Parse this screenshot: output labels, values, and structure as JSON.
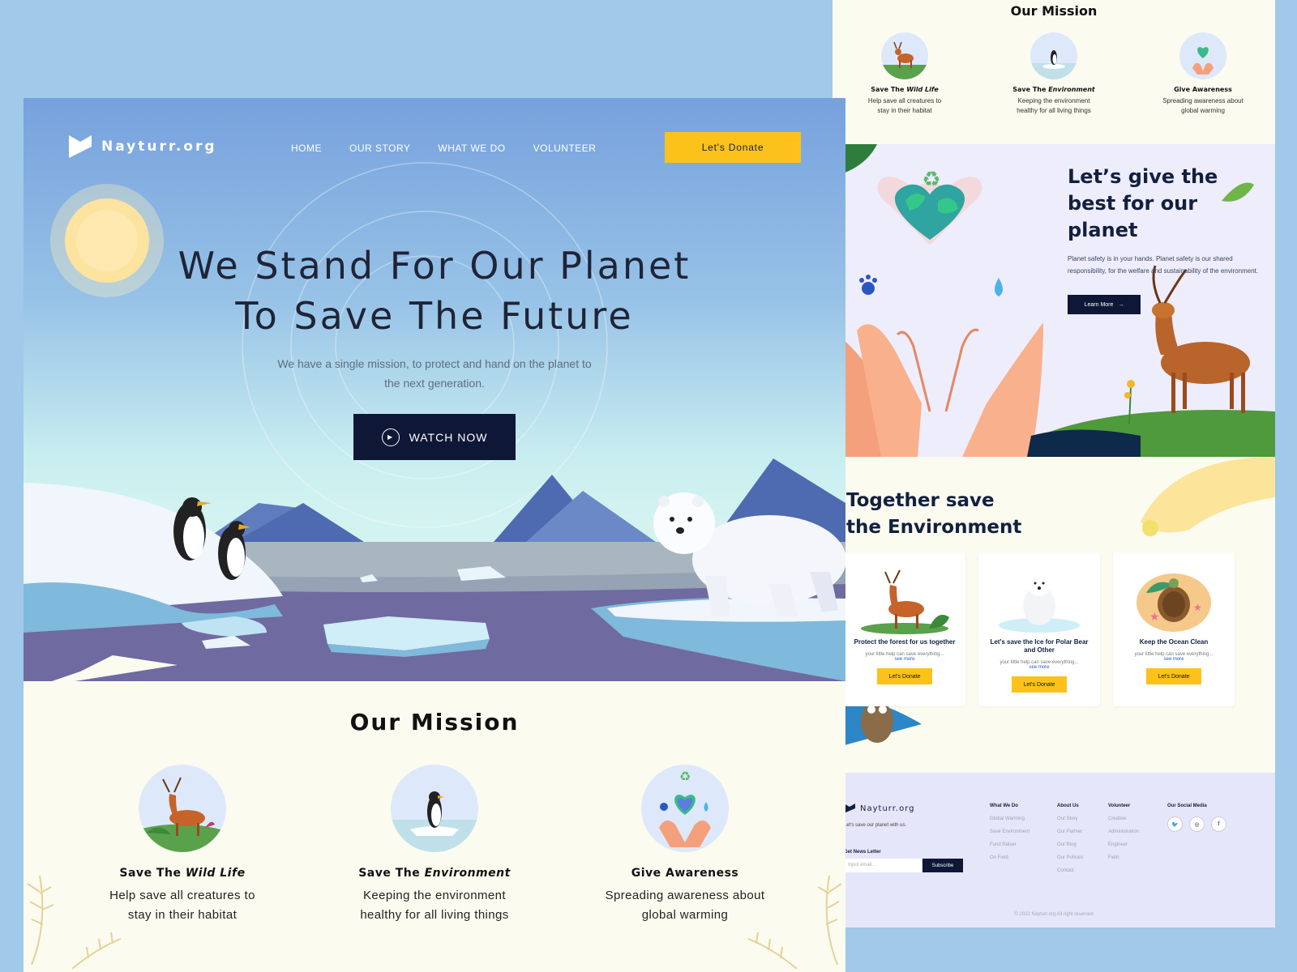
{
  "colors": {
    "accent": "#fcc21b",
    "navy": "#0e1736",
    "sky": "#76a1dd",
    "cream": "#fbfbf0"
  },
  "brand": {
    "name": "Nayturr.org"
  },
  "nav": [
    "HOME",
    "OUR STORY",
    "WHAT WE DO",
    "VOLUNTEER"
  ],
  "hero": {
    "donate_label": "Let's Donate",
    "title_line1": "We Stand For Our Planet",
    "title_line2": "To Save The Future",
    "subtitle_line1": "We have a single mission, to protect and hand on the planet to",
    "subtitle_line2": "the next generation.",
    "watch_label": "WATCH NOW"
  },
  "mission": {
    "title": "Our Mission",
    "items": [
      {
        "prefix": "Save The ",
        "emph": "Wild Life",
        "desc1": "Help save all creatures to",
        "desc2": "stay in their habitat",
        "icon": "deer-icon"
      },
      {
        "prefix": "Save The ",
        "emph": "Environment",
        "desc1": "Keeping the environment",
        "desc2": "healthy for all living things",
        "icon": "penguin-icon"
      },
      {
        "prefix": "Give Awareness",
        "emph": "",
        "desc1": "Spreading awareness about",
        "desc2": "global warming",
        "icon": "earth-heart-icon"
      }
    ]
  },
  "best": {
    "title": "Let’s give the best for our planet",
    "desc": "Planet safety is in your hands. Planet safety is our shared responsibility, for the welfare and sustainability of the environment.",
    "learn_label": "Learn More"
  },
  "together": {
    "title_line1": "Together save",
    "title_line2": "the Environment",
    "cards": [
      {
        "title": "Protect the forest for us together",
        "text": "your little help can save everything...",
        "more": "see more",
        "button": "Let's Donate"
      },
      {
        "title": "Let's save the Ice for Polar Bear and Other",
        "text": "your little help can save everything...",
        "more": "see more",
        "button": "Let's Donate"
      },
      {
        "title": "Keep the Ocean Clean",
        "text": "your little help can save everything...",
        "more": "see more",
        "button": "Let's Donate"
      }
    ]
  },
  "footer": {
    "tagline": "Let's save our planet with us.",
    "newsletter_label": "Get News Letter",
    "input_placeholder": "Input email...",
    "subscribe_label": "Subscribe",
    "columns": [
      {
        "heading": "What We Do",
        "links": [
          "Global Warming",
          "Save Environment",
          "Fund Raiser",
          "On Field"
        ]
      },
      {
        "heading": "About Us",
        "links": [
          "Our Story",
          "Our Partner",
          "Our Blog",
          "Our Policies",
          "Contact"
        ]
      },
      {
        "heading": "Volunteer",
        "links": [
          "Creative",
          "Administration",
          "Engineer",
          "Field"
        ]
      }
    ],
    "social_heading": "Our Social Media",
    "copyright": "© 2022 Nayturr.org All right reserved"
  }
}
